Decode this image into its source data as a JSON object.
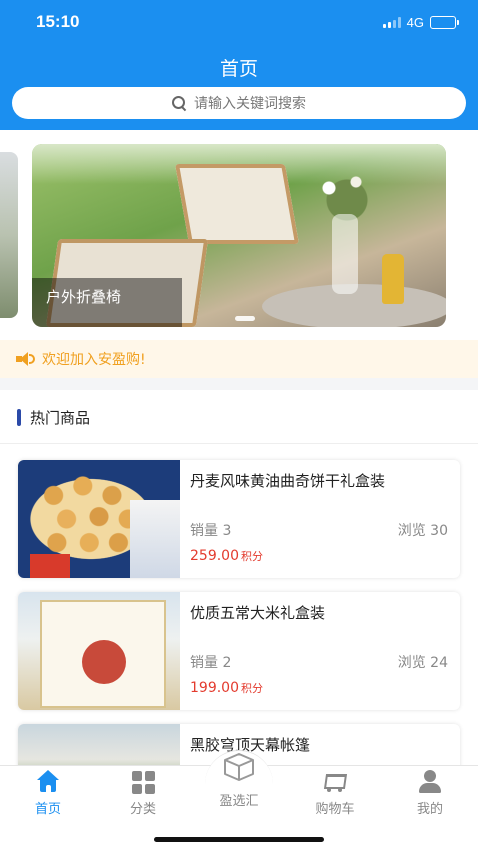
{
  "status_bar": {
    "time": "15:10",
    "network": "4G"
  },
  "header": {
    "title": "首页",
    "search_placeholder": "请输入关键词搜索"
  },
  "banner": {
    "caption": "户外折叠椅"
  },
  "notice": {
    "text": "欢迎加入安盈购!"
  },
  "hot_section": {
    "title": "热门商品",
    "products": [
      {
        "name": "丹麦风味黄油曲奇饼干礼盒装",
        "sales": "销量 3",
        "views": "浏览 30",
        "price": "259.00",
        "price_unit": "积分"
      },
      {
        "name": "优质五常大米礼盒装",
        "sales": "销量 2",
        "views": "浏览 24",
        "price": "199.00",
        "price_unit": "积分"
      },
      {
        "name": "黑胶穹顶天幕帐篷"
      }
    ]
  },
  "tabbar": {
    "items": [
      {
        "label": "首页",
        "icon": "home-icon",
        "active": true
      },
      {
        "label": "分类",
        "icon": "grid-icon"
      },
      {
        "label": "盈选汇",
        "icon": "box-icon"
      },
      {
        "label": "购物车",
        "icon": "cart-icon"
      },
      {
        "label": "我的",
        "icon": "user-icon"
      }
    ]
  },
  "colors": {
    "primary": "#1b8ff0",
    "price": "#e33b2e",
    "notice": "#f0a020"
  }
}
